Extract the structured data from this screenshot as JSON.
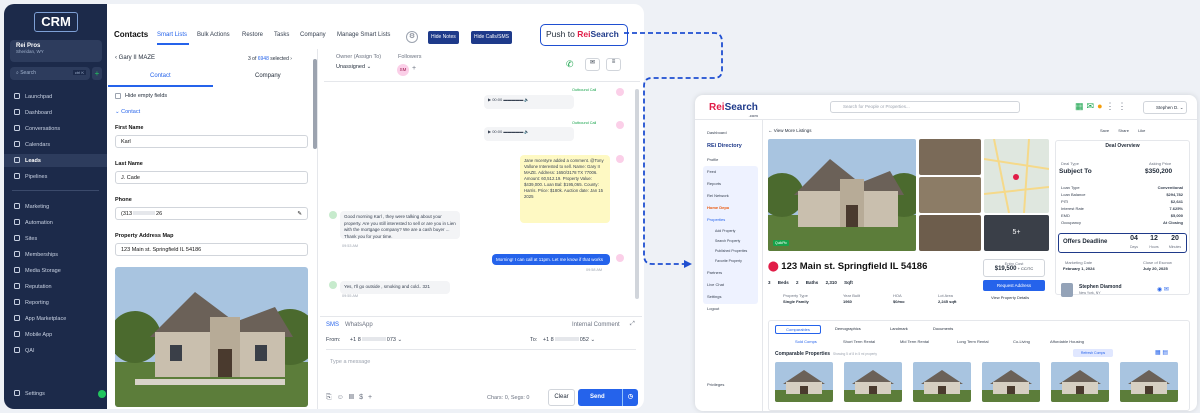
{
  "sidebar": {
    "logo": "CRM",
    "account_name": "Rei Pros",
    "account_location": "Sheridan, WY",
    "search_placeholder": "Search",
    "search_shortcut": "ctrl K",
    "items": [
      {
        "label": "Launchpad"
      },
      {
        "label": "Dashboard"
      },
      {
        "label": "Conversations"
      },
      {
        "label": "Calendars"
      },
      {
        "label": "Leads"
      },
      {
        "label": "Pipelines"
      },
      {
        "label": "Marketing"
      },
      {
        "label": "Automation"
      },
      {
        "label": "Sites"
      },
      {
        "label": "Memberships"
      },
      {
        "label": "Media Storage"
      },
      {
        "label": "Reputation"
      },
      {
        "label": "Reporting"
      },
      {
        "label": "App Marketplace"
      },
      {
        "label": "Mobile App"
      },
      {
        "label": "QAI"
      }
    ],
    "settings": "Settings"
  },
  "topbar": {
    "title": "Contacts",
    "tabs": [
      "Smart Lists",
      "Bulk Actions",
      "Restore",
      "Tasks",
      "Company",
      "Manage Smart Lists"
    ],
    "hide_notes": "Hide Notes",
    "hide_calls": "Hide Calls/SMS",
    "push_prefix": "Push to",
    "push_brand_a": "Rei",
    "push_brand_b": "Search"
  },
  "contact": {
    "name": "Gary II MAZE",
    "pager_prefix": "3 of",
    "pager_total": "6948",
    "pager_suffix": "selected",
    "tab_contact": "Contact",
    "tab_company": "Company",
    "hide_empty": "Hide empty fields",
    "section": "Contact",
    "first_name_label": "First Name",
    "first_name": "Karl",
    "last_name_label": "Last Name",
    "last_name": "J. Cade",
    "phone_label": "Phone",
    "phone": "(313",
    "phone_end": "26",
    "address_label": "Property Address Map",
    "address": "123 Main st. Springfield IL 54186"
  },
  "conversation": {
    "owner_label": "Owner (Assign To)",
    "owner_value": "Unassigned",
    "followers_label": "Followers",
    "follower_initials": "SM",
    "outbound_call": "Outbound Call",
    "audio_time": "00:00",
    "lead_note": "Jane mcentyre added a comment. @Tony Vallone Interested to sell. Name: Gary II MAZE. Address: 1650/3178 TX 77006. Amount: 60,512.19. Property Value: $439,000. Loan Bal: $195,065. County: Harris. Price: $180k. Auction date: Jan 15 2025",
    "msg1": "Good morning Karl , they were talking about your property. Are you still interested to sell or are you in Lien with the mortgage company? We are a cash buyer ... Thank you for your time.",
    "msg1_time": "09:53 AM",
    "msg2": "Morning! I can call at 11pm. Let me know if that works",
    "msg2_time": "09:58 AM",
    "msg3": "Yes, I'll go outside , smoking and cold.. 321",
    "msg3_time": "09:55 AM",
    "compose_tabs": [
      "SMS",
      "WhatsApp"
    ],
    "internal_comment": "Internal Comment",
    "from_label": "From:",
    "from_value": "+1 8",
    "from_end": "073",
    "to_label": "To:",
    "to_value": "+1 8",
    "to_end": "052",
    "placeholder": "Type a message",
    "chars": "Chars: 0, Segs: 0",
    "clear": "Clear",
    "send": "Send"
  },
  "reisearch": {
    "logo_a": "Rei",
    "logo_b": "Search",
    "logo_sub": ".com",
    "search_placeholder": "Search for People or Properties...",
    "user": "Stephen D.",
    "side_items": [
      "Dashboard",
      "REi Directory",
      "Profile",
      "Feed",
      "Reports",
      "Rei Network",
      "Home Depo",
      "Properties",
      "Add Property",
      "Search Property",
      "Published Properties",
      "Favorite Property",
      "Partners",
      "Live Chat",
      "Settings",
      "Logout",
      "Privileges"
    ],
    "directory_title": "REi Directory",
    "back_link": "View More Listings",
    "actions": [
      "Save",
      "Share",
      "Like"
    ],
    "deal_title": "Deal Overview",
    "deal_type_label": "Deal Type",
    "deal_type": "Subject To",
    "asking_label": "Asking Price",
    "asking": "$350,200",
    "rows": [
      {
        "k": "Loan Type",
        "v": "Conventional"
      },
      {
        "k": "Loan Balance",
        "v": "$294,782"
      },
      {
        "k": "PITI",
        "v": "$2,641"
      },
      {
        "k": "Interest Rate",
        "v": "7.625%"
      },
      {
        "k": "EMD",
        "v": "$5,000"
      },
      {
        "k": "Occupancy",
        "v": "At Closing"
      }
    ],
    "offers_label": "Offers Deadline",
    "countdown": [
      {
        "v": "04",
        "u": "Days"
      },
      {
        "v": "12",
        "u": "Hours"
      },
      {
        "v": "20",
        "u": "Minutes"
      }
    ],
    "mkt_date_label": "Marketing Date",
    "mkt_date": "February 1, 2024",
    "close_label": "Close of Escrow",
    "close_date": "July 20, 2025",
    "address": "123 Main st. Springfield IL 54186",
    "beds": "3 Beds",
    "baths": "2 Baths",
    "sqft": "2,310 Sqft",
    "entry_label": "Entry Cost",
    "entry": "$19,500",
    "entry_suffix": "+ CC/TC",
    "request_btn": "Request Address",
    "view_details": "View Property Details",
    "facts": [
      {
        "k": "Property Type",
        "v": "Single Family"
      },
      {
        "k": "Year Built",
        "v": "1960"
      },
      {
        "k": "HOA",
        "v": "$0/mo"
      },
      {
        "k": "Lot Area",
        "v": "2,245 sqft"
      }
    ],
    "agent_name": "Stephen Diamond",
    "agent_loc": "New York, NY",
    "gallery_more": "5+",
    "badge": "QuikPic",
    "tabs": [
      "Comparables",
      "Demographics",
      "Landmark",
      "Documents"
    ],
    "subtabs": [
      "Sold Comps",
      "Short Term Rental",
      "Mid Term Rental",
      "Long Term Rental",
      "Co-Living",
      "Affordable Housing"
    ],
    "comp_title": "Comparable Properties",
    "comp_sub": "Showing 5 of 8 in 5 mi property",
    "refresh": "Refresh Comps",
    "thumbs": 6
  },
  "colors": {
    "navy": "#1c2a4a",
    "accent": "#2563eb",
    "brand_red": "#e11d48",
    "brand_blue": "#1f3a8a"
  }
}
